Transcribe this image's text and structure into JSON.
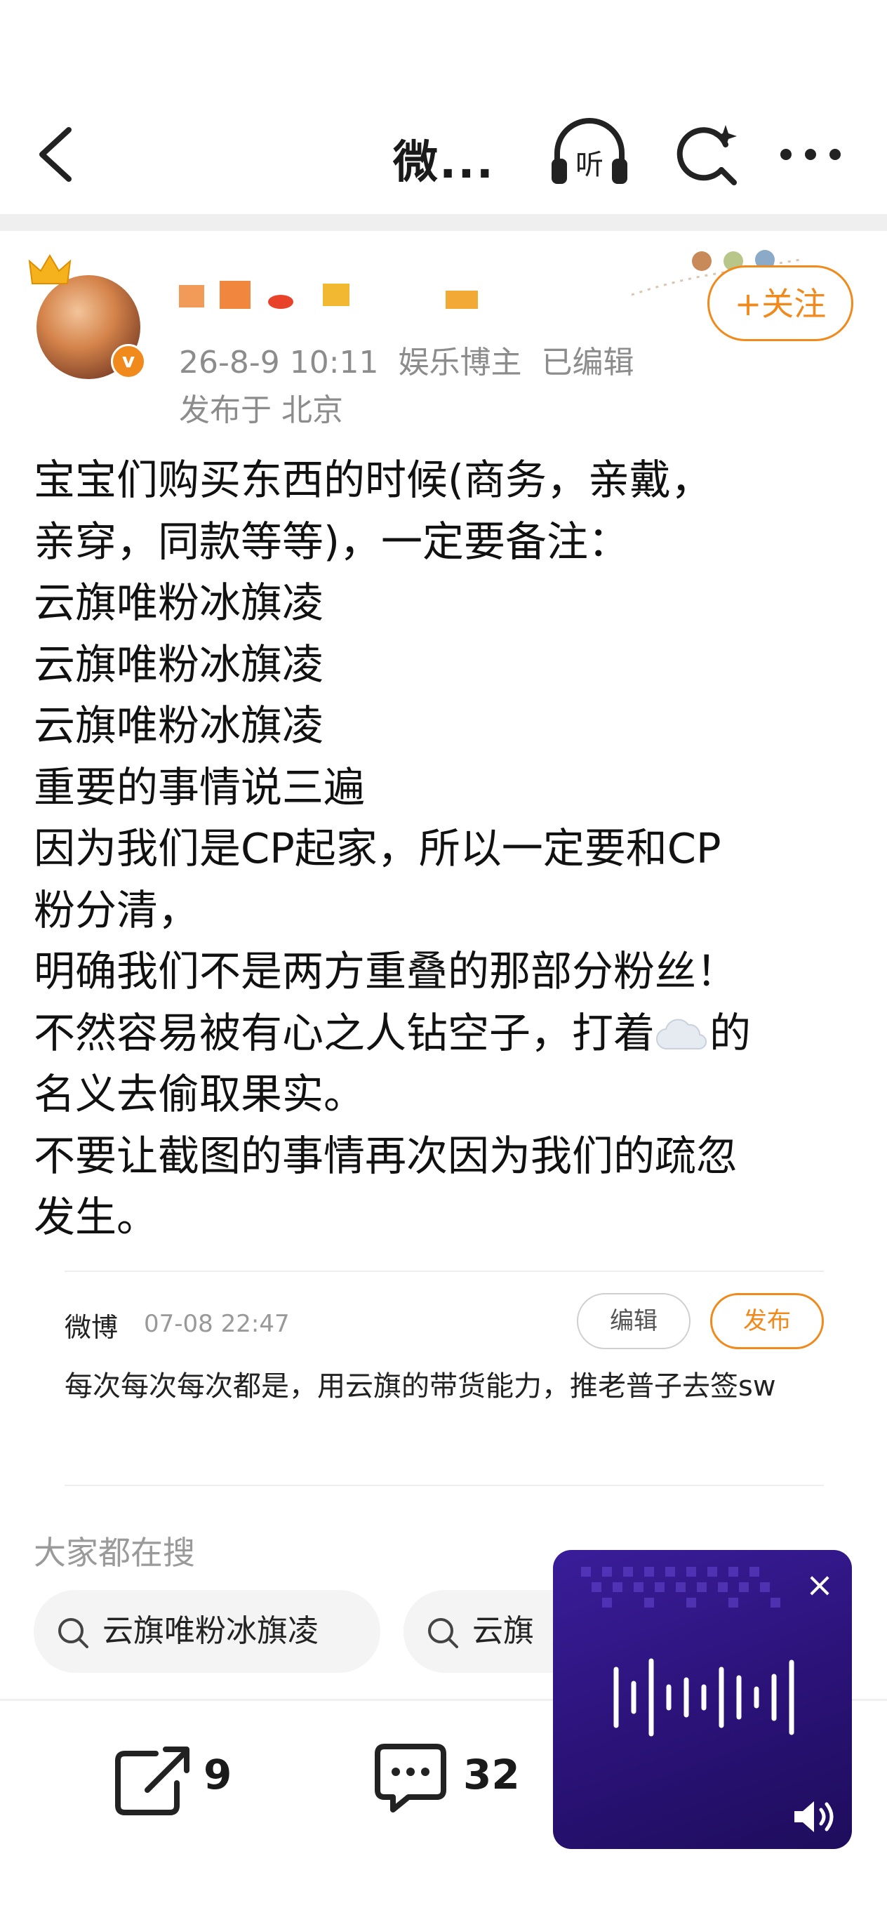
{
  "header": {
    "title": "微...",
    "listen_icon_text": "听"
  },
  "post": {
    "author_name": "",
    "meta": [
      "26-8-9 10:11",
      "娱乐博主",
      "已编辑"
    ],
    "location": "发布于 北京",
    "follow_label": "+关注",
    "verified_badge": "v",
    "body_lines": [
      "宝宝们购买东西的时候(商务，亲戴，",
      "亲穿，同款等等)，一定要备注：",
      "云旗唯粉冰旗凌",
      "云旗唯粉冰旗凌",
      "云旗唯粉冰旗凌",
      "重要的事情说三遍",
      "因为我们是CP起家，所以一定要和CP",
      "粉分清，",
      "明确我们不是两方重叠的那部分粉丝！",
      "不然容易被有心之人钻空子，打着",
      "的",
      "名义去偷取果实。",
      "不要让截图的事情再次因为我们的疏忽",
      "发生。"
    ]
  },
  "draft": {
    "source": "微博",
    "time": "07-08 22:47",
    "edit_label": "编辑",
    "publish_label": "发布",
    "text": "每次每次每次都是，用云旗的带货能力，推老普子去签sw"
  },
  "searches": {
    "title": "大家都在搜",
    "items": [
      "云旗唯粉冰旗凌",
      "云旗"
    ]
  },
  "actions": {
    "repost_count": "9",
    "comment_count": "32"
  },
  "player": {
    "close_label": "×"
  },
  "colors": {
    "accent": "#f08a1c",
    "player_bg": "#2a1277",
    "muted_text": "#8c8c8c"
  },
  "icons": [
    "back-icon",
    "headphones-icon",
    "refresh-search-icon",
    "more-icon",
    "crown-icon",
    "cloud-emoji-icon",
    "search-icon",
    "repost-icon",
    "comment-icon",
    "close-icon",
    "soundwave-icon",
    "speaker-icon"
  ]
}
